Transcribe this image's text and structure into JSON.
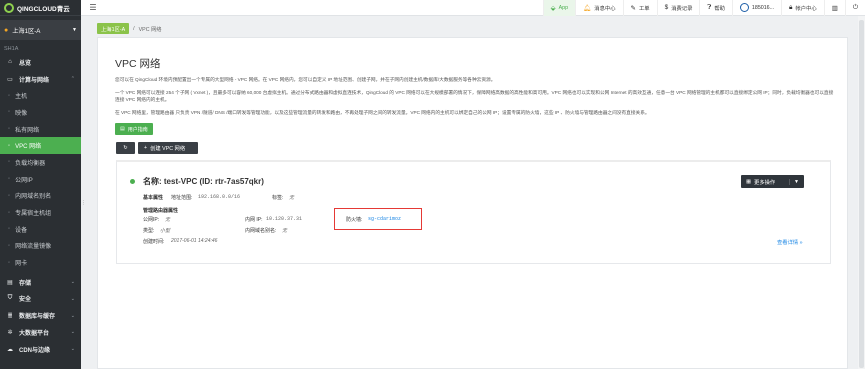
{
  "brand": {
    "name": "QINGCLOUD青云"
  },
  "region": {
    "label": "上海1区-A",
    "zone": "SH1A"
  },
  "sidebar": {
    "overview": "总览",
    "compute": "计算与网络",
    "items": [
      "主机",
      "映像",
      "私有网络",
      "VPC 网络",
      "负载均衡器",
      "公网IP",
      "内网域名别名",
      "专属宿主机组",
      "设备",
      "网络流量镜像",
      "网卡"
    ],
    "sections": [
      "存储",
      "安全",
      "数据库与缓存",
      "大数据平台",
      "CDN与边缘"
    ]
  },
  "topbar": {
    "app": "App",
    "notifications": "消息中心",
    "tickets": "工单",
    "billing": "消费记录",
    "help": "帮助",
    "user": "185016...",
    "account": "帐户中心"
  },
  "breadcrumb": {
    "region": "上海1区-A",
    "sep": "/",
    "page": "VPC 网络"
  },
  "page": {
    "title": "VPC 网络",
    "desc1": "您可以在 QingCloud 环境内预配置出一个专属的大型网络 - VPC 网络。在 VPC 网络内，您可以自定义 IP 地址范围、创建子网，并在子网内创建主机/数据库/大数据服务等各种云资源。",
    "desc2": "一个 VPC 网络可以连接 254 个子网 ( Vxnet )，且最多可以容纳 60,000 台虚拟主机。通过分布式路由器和虚拟直连技术，QingCloud 的 VPC 网络可以在大规模部署的情况下，保障网络高数据的高性能和高可用。VPC 网络也可以实现和公网 Internet 的高效互通，任意一台 VPC 网络管理的主机都可以直接绑定公网 IP；同时，负载均衡器也可以直接连接 VPC 网络内的主机。",
    "desc3": "在 VPC 网络里，管理路由器 只负责 VPN /隧道/ DNS /端口转发等管理功能，以及这些管理流量的转发和路由，不再处理子网之间的转发流量。VPC 网络内的主机可以绑定自己的公网 IP；设置专属的防火墙，这些 IP 、防火墙与管理路由器之间没有直接关系。",
    "user_guide_btn": "用户指南",
    "create_btn": "创建 VPC 网络"
  },
  "vpc": {
    "title": "名称: test-VPC (ID: rtr-7as57qkr)",
    "more": "更多操作",
    "basic_label": "基本属性",
    "range_label": "地址范围:",
    "range_value": "192.168.0.0/16",
    "tag_label": "标签:",
    "tag_value": "无",
    "router_label": "管理路由器属性",
    "public_ip_label": "公网IP:",
    "public_ip_value": "无",
    "private_ip_label": "内网 IP:",
    "private_ip_value": "10.120.37.31",
    "firewall_label": "防火墙:",
    "firewall_value": "sg-cdarimoz",
    "type_label": "类型:",
    "type_value": "小型",
    "domain_label": "内网域名别名:",
    "domain_value": "无",
    "created_label": "创建时间:",
    "created_value": "2017-06-01 14:24:46",
    "details": "查看详情 »"
  },
  "colors": {
    "accent": "#4caf50",
    "sidebar": "#2b2f33",
    "highlight": "#e53935",
    "link": "#1e88e5"
  }
}
